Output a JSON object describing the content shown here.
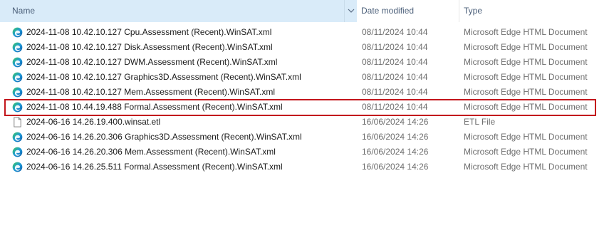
{
  "columns": {
    "name": "Name",
    "date_modified": "Date modified",
    "type": "Type"
  },
  "files": [
    {
      "name": "2024-11-08 10.42.10.127 Cpu.Assessment (Recent).WinSAT.xml",
      "date": "08/11/2024 10:44",
      "type": "Microsoft Edge HTML Document",
      "icon": "edge-icon"
    },
    {
      "name": "2024-11-08 10.42.10.127 Disk.Assessment (Recent).WinSAT.xml",
      "date": "08/11/2024 10:44",
      "type": "Microsoft Edge HTML Document",
      "icon": "edge-icon"
    },
    {
      "name": "2024-11-08 10.42.10.127 DWM.Assessment (Recent).WinSAT.xml",
      "date": "08/11/2024 10:44",
      "type": "Microsoft Edge HTML Document",
      "icon": "edge-icon"
    },
    {
      "name": "2024-11-08 10.42.10.127 Graphics3D.Assessment (Recent).WinSAT.xml",
      "date": "08/11/2024 10:44",
      "type": "Microsoft Edge HTML Document",
      "icon": "edge-icon"
    },
    {
      "name": "2024-11-08 10.42.10.127 Mem.Assessment (Recent).WinSAT.xml",
      "date": "08/11/2024 10:44",
      "type": "Microsoft Edge HTML Document",
      "icon": "edge-icon"
    },
    {
      "name": "2024-11-08 10.44.19.488 Formal.Assessment (Recent).WinSAT.xml",
      "date": "08/11/2024 10:44",
      "type": "Microsoft Edge HTML Document",
      "icon": "edge-icon",
      "highlighted": true
    },
    {
      "name": "2024-06-16 14.26.19.400.winsat.etl",
      "date": "16/06/2024 14:26",
      "type": "ETL File",
      "icon": "file-icon"
    },
    {
      "name": "2024-06-16 14.26.20.306 Graphics3D.Assessment (Recent).WinSAT.xml",
      "date": "16/06/2024 14:26",
      "type": "Microsoft Edge HTML Document",
      "icon": "edge-icon"
    },
    {
      "name": "2024-06-16 14.26.20.306 Mem.Assessment (Recent).WinSAT.xml",
      "date": "16/06/2024 14:26",
      "type": "Microsoft Edge HTML Document",
      "icon": "edge-icon"
    },
    {
      "name": "2024-06-16 14.26.25.511 Formal.Assessment (Recent).WinSAT.xml",
      "date": "16/06/2024 14:26",
      "type": "Microsoft Edge HTML Document",
      "icon": "edge-icon"
    }
  ],
  "colors": {
    "header_selected_bg": "#d9ebf9",
    "highlight_border": "#c3161c",
    "edge_blue": "#0c59a4",
    "edge_green": "#3cc85a"
  }
}
